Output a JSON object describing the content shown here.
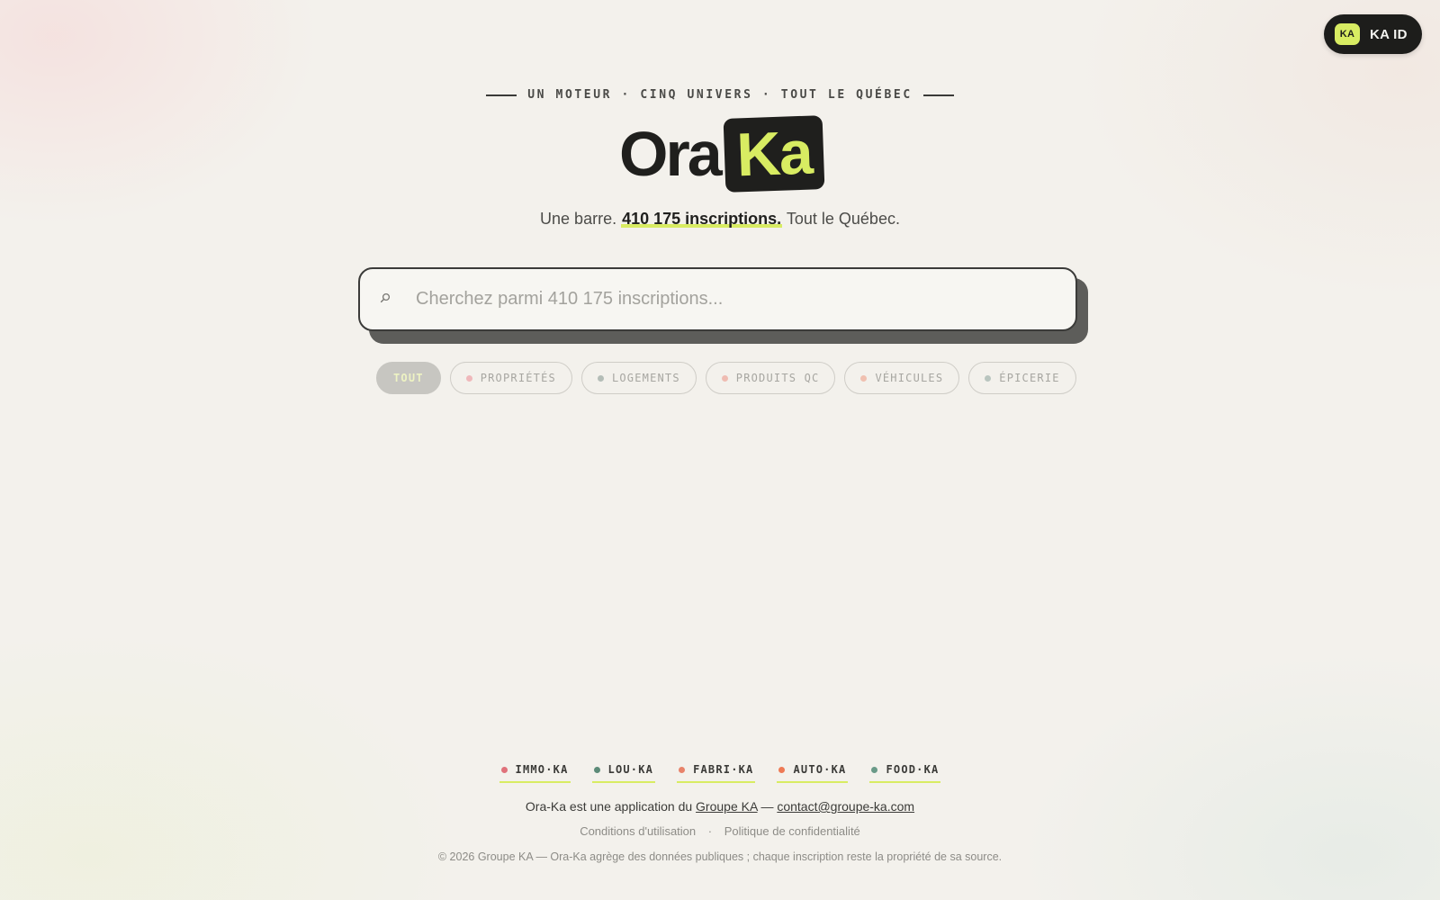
{
  "account": {
    "badge": "KA",
    "label": "KA ID"
  },
  "hero": {
    "tagline": "UN MOTEUR · CINQ UNIVERS · TOUT LE QUÉBEC",
    "logo_part1": "Ora",
    "logo_part2": "Ka",
    "subtitle_prefix": "Une barre.",
    "subtitle_highlight": "410 175 inscriptions.",
    "subtitle_suffix": "Tout le Québec."
  },
  "search": {
    "icon": "search-icon",
    "placeholder": "Cherchez parmi 410 175 inscriptions...",
    "value": ""
  },
  "filters": [
    {
      "label": "TOUT",
      "active": true,
      "dot_color": null
    },
    {
      "label": "PROPRIÉTÉS",
      "active": false,
      "dot_color": "#efb8bb"
    },
    {
      "label": "LOGEMENTS",
      "active": false,
      "dot_color": "#b4bdb7"
    },
    {
      "label": "PRODUITS QC",
      "active": false,
      "dot_color": "#efbcb2"
    },
    {
      "label": "VÉHICULES",
      "active": false,
      "dot_color": "#f0c0b0"
    },
    {
      "label": "ÉPICERIE",
      "active": false,
      "dot_color": "#b9c5bf"
    }
  ],
  "footer": {
    "brands": [
      {
        "label": "IMMO·KA",
        "dot_color": "#e0727b"
      },
      {
        "label": "LOU·KA",
        "dot_color": "#5c8b78"
      },
      {
        "label": "FABRI·KA",
        "dot_color": "#e8836a"
      },
      {
        "label": "AUTO·KA",
        "dot_color": "#ee7a55"
      },
      {
        "label": "FOOD·KA",
        "dot_color": "#6a9a88"
      }
    ],
    "about_prefix": "Ora-Ka est une application du",
    "about_link": "Groupe KA",
    "about_dash": "—",
    "contact_email": "contact@groupe-ka.com",
    "terms": "Conditions d'utilisation",
    "separator": "·",
    "privacy": "Politique de confidentialité",
    "copyright": "© 2026 Groupe KA — Ora-Ka agrège des données publiques ; chaque inscription reste la propriété de sa source."
  }
}
